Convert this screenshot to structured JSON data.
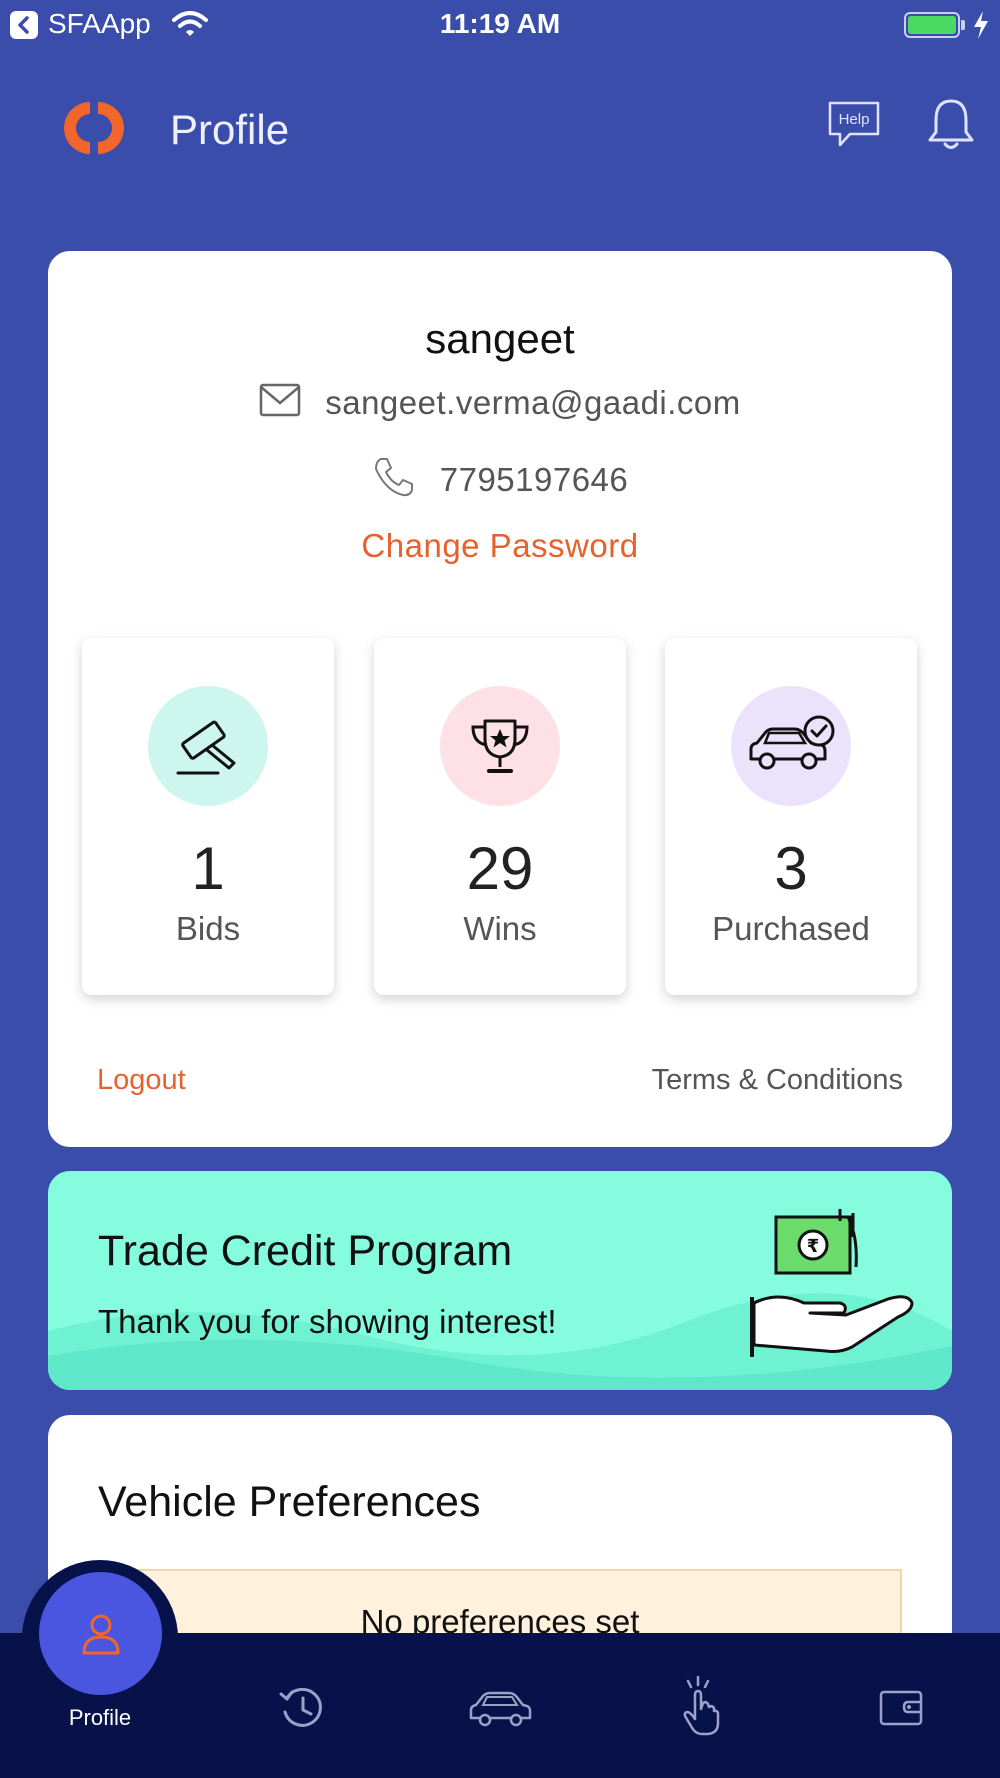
{
  "status_bar": {
    "app_name": "SFAApp",
    "time": "11:19 AM",
    "battery_color": "#4cd964"
  },
  "header": {
    "title": "Profile",
    "help_label": "Help",
    "logo_color": "#f2652b"
  },
  "profile": {
    "name": "sangeet",
    "email": "sangeet.verma@gaadi.com",
    "phone": "7795197646",
    "change_password_label": "Change Password",
    "stats": [
      {
        "value": "1",
        "label": "Bids",
        "icon": "gavel-icon",
        "circle_color": "#cdf6ef"
      },
      {
        "value": "29",
        "label": "Wins",
        "icon": "trophy-icon",
        "circle_color": "#fde1e6"
      },
      {
        "value": "3",
        "label": "Purchased",
        "icon": "car-check-icon",
        "circle_color": "#ebe3fc"
      }
    ],
    "logout_label": "Logout",
    "terms_label": "Terms & Conditions"
  },
  "trade_credit": {
    "title": "Trade Credit Program",
    "subtitle": "Thank you for showing interest!",
    "background_color": "#86fcdf",
    "currency_symbol": "₹"
  },
  "vehicle_preferences": {
    "title": "Vehicle Preferences",
    "empty_text": "No preferences set"
  },
  "bottom_nav": {
    "active_label": "Profile",
    "items": [
      {
        "icon": "user-icon",
        "label": "Profile",
        "active": true
      },
      {
        "icon": "history-icon"
      },
      {
        "icon": "car-icon"
      },
      {
        "icon": "tap-icon"
      },
      {
        "icon": "wallet-icon"
      }
    ],
    "background_color": "#08124a",
    "active_color": "#4a55e0"
  },
  "colors": {
    "page_background": "#3b4daa",
    "accent": "#e8612c"
  }
}
